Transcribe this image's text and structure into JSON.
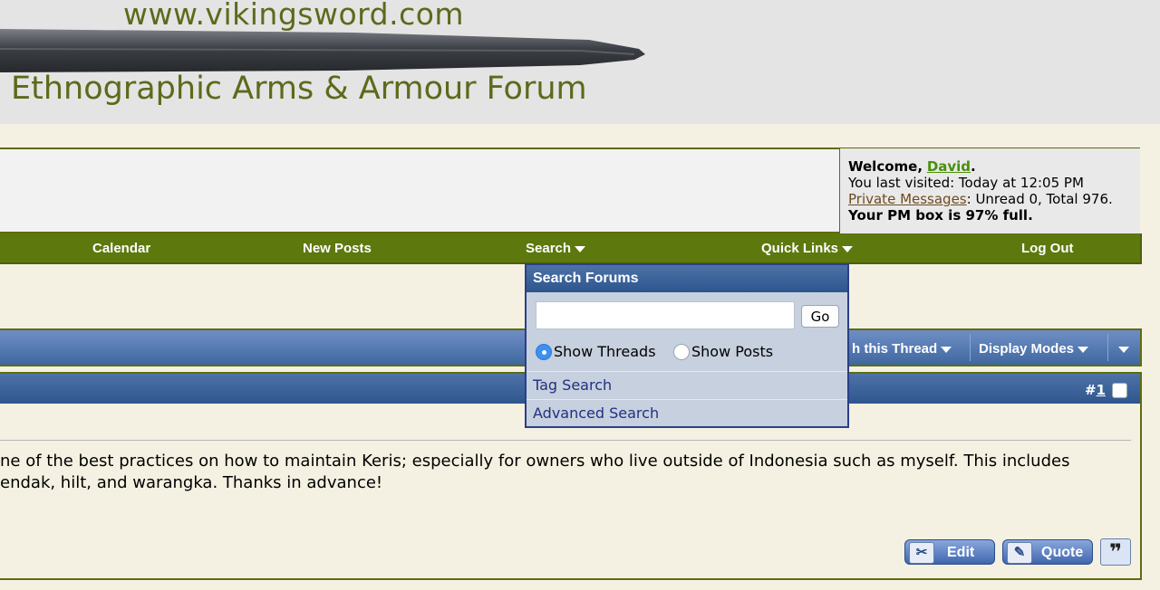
{
  "header": {
    "site_url": "www.vikingsword.com",
    "forum_title": "Ethnographic Arms & Armour Forum"
  },
  "welcome": {
    "greeting": "Welcome,",
    "username": "David",
    "last_visited": "You last visited: Today at 12:05 PM",
    "pm_link": "Private Messages",
    "pm_status": ": Unread 0, Total 976.",
    "pm_box": "Your PM box is 97% full."
  },
  "navbar": {
    "items": [
      "Calendar",
      "New Posts",
      "Search",
      "Quick Links",
      "Log Out"
    ]
  },
  "thread_tools": {
    "search_thread": "h this Thread",
    "display_modes": "Display Modes"
  },
  "post": {
    "number_prefix": "#",
    "number": "1",
    "lines": [
      "ne of the best practices on how to maintain Keris; especially for owners who live outside of Indonesia such as myself. This includes",
      "endak, hilt, and warangka. Thanks in advance!"
    ],
    "actions": {
      "edit": "Edit",
      "quote": "Quote"
    }
  },
  "search_menu": {
    "title": "Search Forums",
    "input_value": "",
    "go_label": "Go",
    "option_threads": "Show Threads",
    "option_posts": "Show Posts",
    "selected": "Show Threads",
    "links": [
      "Tag Search",
      "Advanced Search"
    ]
  },
  "colors": {
    "nav_green": "#5d780d",
    "blue_bar": "#40679f",
    "page_bg": "#f5f1e2"
  }
}
